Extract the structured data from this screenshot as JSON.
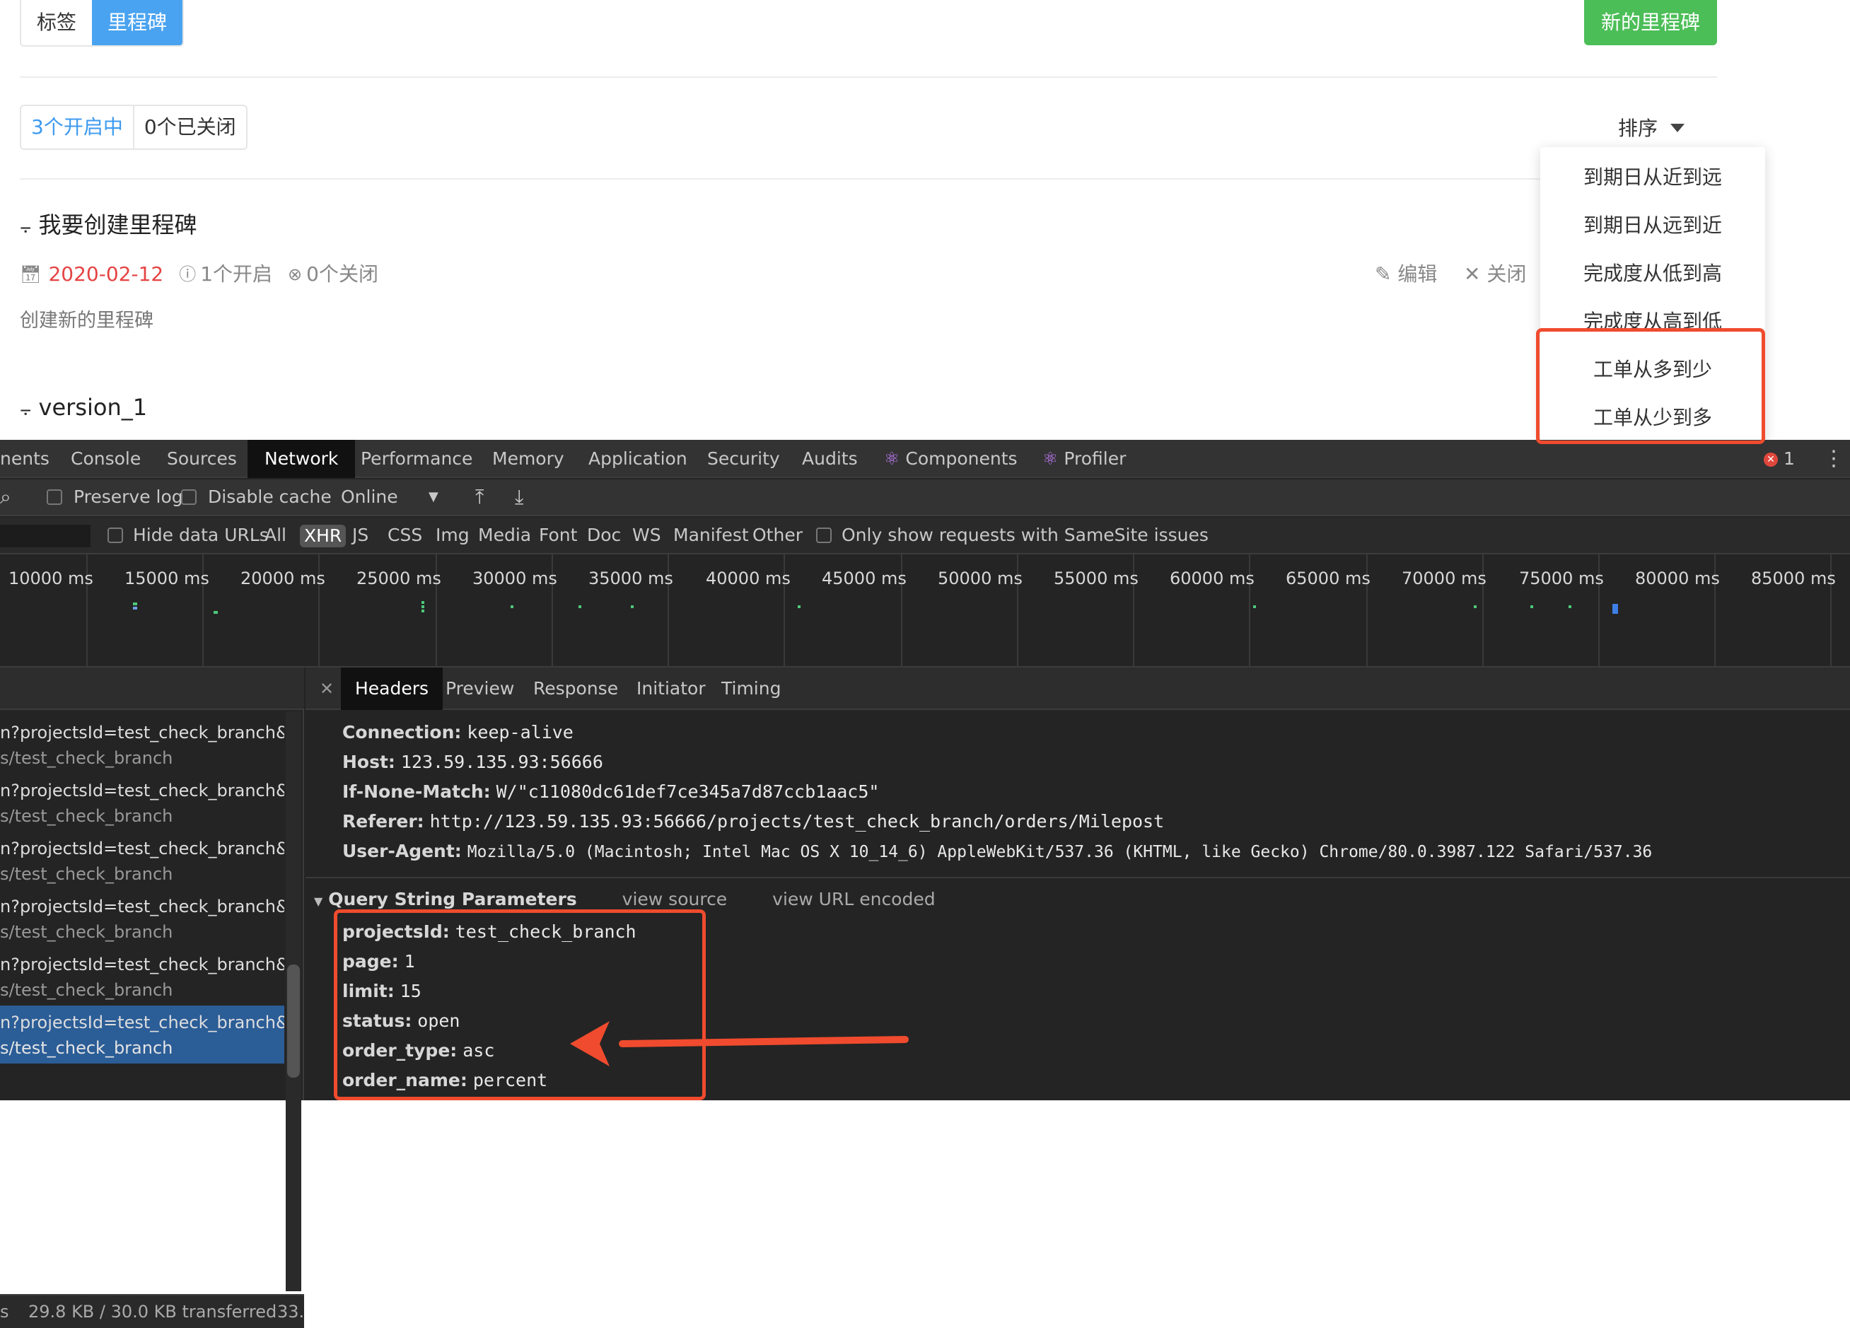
{
  "app": {
    "tabs": [
      "标签",
      "里程碑"
    ],
    "new_milestone_button": "新的里程碑",
    "status_filters": [
      "3个开启中",
      "0个已关闭"
    ],
    "sort_label": "排序",
    "sort_options": [
      "到期日从近到远",
      "到期日从远到近",
      "完成度从低到高",
      "完成度从高到低",
      "工单从多到少",
      "工单从少到多"
    ],
    "milestones": [
      {
        "title": "我要创建里程碑",
        "due_date": "2020-02-12",
        "open_count": "1个开启",
        "closed_count": "0个关闭",
        "description": "创建新的里程碑",
        "edit_label": "编辑",
        "close_label": "关闭"
      },
      {
        "title": "version_1"
      }
    ]
  },
  "devtools": {
    "tabs": [
      "nents",
      "Console",
      "Sources",
      "Network",
      "Performance",
      "Memory",
      "Application",
      "Security",
      "Audits",
      "Components",
      "Profiler"
    ],
    "active_tab": "Network",
    "error_count": "1",
    "toolbar": {
      "preserve_log": "Preserve log",
      "disable_cache": "Disable cache",
      "throttle": "Online"
    },
    "filter_bar": {
      "hide_data_urls": "Hide data URLs",
      "types": [
        "All",
        "XHR",
        "JS",
        "CSS",
        "Img",
        "Media",
        "Font",
        "Doc",
        "WS",
        "Manifest",
        "Other"
      ],
      "active_type": "XHR",
      "samesite": "Only show requests with SameSite issues"
    },
    "timeline_ticks": [
      "10000 ms",
      "15000 ms",
      "20000 ms",
      "25000 ms",
      "30000 ms",
      "35000 ms",
      "40000 ms",
      "45000 ms",
      "50000 ms",
      "55000 ms",
      "60000 ms",
      "65000 ms",
      "70000 ms",
      "75000 ms",
      "80000 ms",
      "85000 ms"
    ],
    "requests": [
      {
        "line1": "n?projectsId=test_check_branch&pa.",
        "line2": "s/test_check_branch"
      },
      {
        "line1": "n?projectsId=test_check_branch&pa.",
        "line2": "s/test_check_branch"
      },
      {
        "line1": "n?projectsId=test_check_branch&pa.",
        "line2": "s/test_check_branch"
      },
      {
        "line1": "n?projectsId=test_check_branch&pa.",
        "line2": "s/test_check_branch"
      },
      {
        "line1": "n?projectsId=test_check_branch&pa.",
        "line2": "s/test_check_branch"
      },
      {
        "line1": "n?projectsId=test_check_branch&pa.",
        "line2": "s/test_check_branch"
      }
    ],
    "footer": {
      "left": "s",
      "transferred": "29.8 KB / 30.0 KB transferred",
      "right": "33."
    },
    "detail_tabs": [
      "Headers",
      "Preview",
      "Response",
      "Initiator",
      "Timing"
    ],
    "headers": [
      {
        "key": "Connection:",
        "value": "keep-alive"
      },
      {
        "key": "Host:",
        "value": "123.59.135.93:56666"
      },
      {
        "key": "If-None-Match:",
        "value": "W/\"c11080dc61def7ce345a7d87ccb1aac5\""
      },
      {
        "key": "Referer:",
        "value": "http://123.59.135.93:56666/projects/test_check_branch/orders/Milepost"
      },
      {
        "key": "User-Agent:",
        "value": "Mozilla/5.0 (Macintosh; Intel Mac OS X 10_14_6) AppleWebKit/537.36 (KHTML, like Gecko) Chrome/80.0.3987.122 Safari/537.36"
      }
    ],
    "qsp": {
      "title": "Query String Parameters",
      "view_source": "view source",
      "view_url_encoded": "view URL encoded",
      "params": [
        {
          "key": "projectsId:",
          "value": "test_check_branch"
        },
        {
          "key": "page:",
          "value": "1"
        },
        {
          "key": "limit:",
          "value": "15"
        },
        {
          "key": "status:",
          "value": "open"
        },
        {
          "key": "order_type:",
          "value": "asc"
        },
        {
          "key": "order_name:",
          "value": "percent"
        }
      ]
    }
  },
  "colors": {
    "accent_blue": "#4aa3f0",
    "new_button_green": "#4cbe58",
    "annotation_red": "#f04b2e",
    "date_red": "#e54343",
    "devtools_bg": "#242424",
    "selected_row": "#2b5d97"
  }
}
